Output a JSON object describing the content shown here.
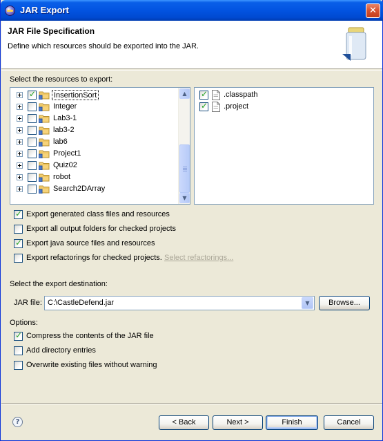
{
  "window": {
    "title": "JAR Export",
    "close_glyph": "✕"
  },
  "header": {
    "title": "JAR File Specification",
    "description": "Define which resources should be exported into the JAR.",
    "icon": "jar-icon"
  },
  "resources": {
    "label": "Select the resources to export:",
    "tree": [
      {
        "label": "InsertionSort",
        "checked": true,
        "selected": true
      },
      {
        "label": "Integer",
        "checked": false,
        "selected": false
      },
      {
        "label": "Lab3-1",
        "checked": false,
        "selected": false
      },
      {
        "label": "lab3-2",
        "checked": false,
        "selected": false
      },
      {
        "label": "lab6",
        "checked": false,
        "selected": false
      },
      {
        "label": "Project1",
        "checked": false,
        "selected": false
      },
      {
        "label": "Quiz02",
        "checked": false,
        "selected": false
      },
      {
        "label": "robot",
        "checked": false,
        "selected": false
      },
      {
        "label": "Search2DArray",
        "checked": false,
        "selected": false
      }
    ],
    "files": [
      {
        "label": ".classpath",
        "checked": true
      },
      {
        "label": ".project",
        "checked": true
      }
    ]
  },
  "export_options": {
    "class_files": {
      "label": "Export generated class files and resources",
      "checked": true
    },
    "output_folders": {
      "label": "Export all output folders for checked projects",
      "checked": false
    },
    "java_source": {
      "label": "Export java source files and resources",
      "checked": true
    },
    "refactorings": {
      "label": "Export refactorings for checked projects.",
      "checked": false
    },
    "select_refactorings_link": "Select refactorings..."
  },
  "destination": {
    "label": "Select the export destination:",
    "jar_file_label": "JAR file:",
    "jar_file_value": "C:\\CastleDefend.jar",
    "browse_label": "Browse..."
  },
  "options": {
    "label": "Options:",
    "compress": {
      "label": "Compress the contents of the JAR file",
      "checked": true
    },
    "directory_entries": {
      "label": "Add directory entries",
      "checked": false
    },
    "overwrite": {
      "label": "Overwrite existing files without warning",
      "checked": false
    }
  },
  "buttons": {
    "help_glyph": "?",
    "back": "< Back",
    "next": "Next >",
    "finish": "Finish",
    "cancel": "Cancel"
  },
  "colors": {
    "titlebar": "#0254e1",
    "dialog_bg": "#ece9d8",
    "border": "#7f9db9",
    "check": "#21a121",
    "disabled_link": "#aca899"
  }
}
